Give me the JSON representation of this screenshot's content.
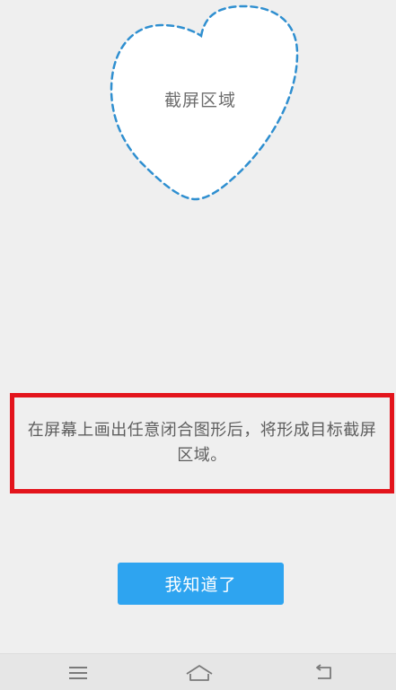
{
  "overlay": {
    "shape_label": "截屏区域",
    "hint_text": "在屏幕上画出任意闭合图形后，将形成目标截屏区域。",
    "confirm_label": "我知道了"
  },
  "nav": {
    "menu_icon": "menu-icon",
    "home_icon": "home-icon",
    "back_icon": "back-icon"
  },
  "colors": {
    "background": "#efefef",
    "dashed_outline": "#2f8fd0",
    "highlight_border": "#e3141c",
    "button": "#2ea4f0"
  }
}
